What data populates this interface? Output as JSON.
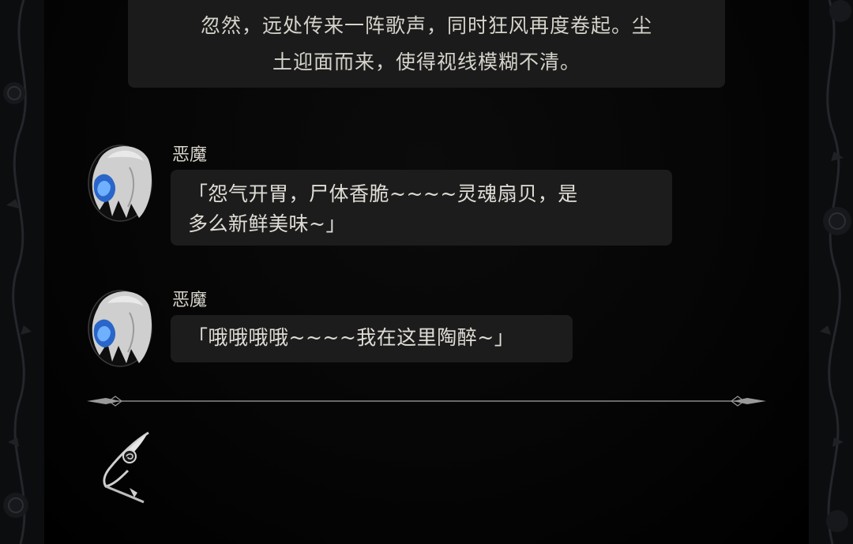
{
  "narration": {
    "line1": "忽然，远处传来一阵歌声，同时狂风再度卷起。尘",
    "line2": "土迎面而来，使得视线模糊不清。"
  },
  "dialogue": [
    {
      "speaker": "恶魔",
      "line1": "「怨气开胃，尸体香脆~~~~灵魂扇贝，是",
      "line2": "多么新鲜美味~」"
    },
    {
      "speaker": "恶魔",
      "line1": "「哦哦哦哦~~~~我在这里陶醉~」"
    }
  ],
  "icons": {
    "avatar": "demon-avatar-icon",
    "divider": "ornamental-divider",
    "quill": "quill-rose-icon"
  },
  "colors": {
    "background": "#000000",
    "bubble": "#1c1c1c",
    "text": "#e0ddd6",
    "avatar_flame": "#3b7bd9"
  }
}
